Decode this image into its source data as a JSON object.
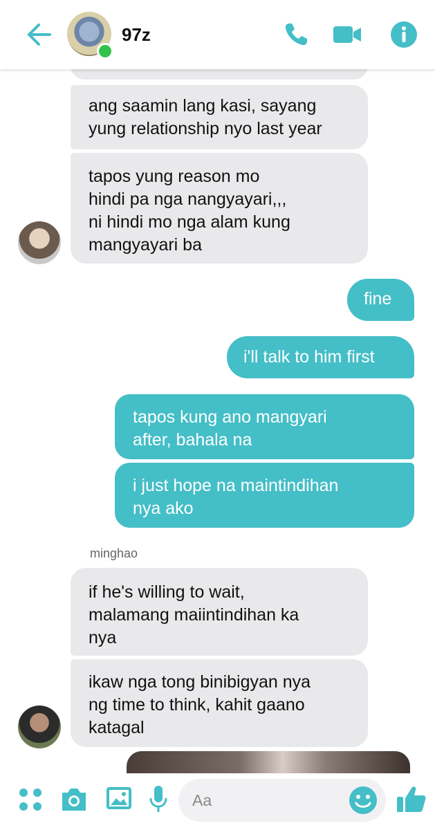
{
  "header": {
    "title": "97z",
    "icons": [
      "back-arrow-icon",
      "phone-icon",
      "video-camera-icon",
      "info-icon"
    ]
  },
  "conversation": {
    "messages": [
      {
        "side": "in",
        "text": "ang saamin lang kasi, sayang\nyung relationship nyo last year"
      },
      {
        "side": "in",
        "text": "tapos yung reason mo\nhindi pa nga nangyayari,,,\nni hindi mo nga alam kung\nmangyayari ba"
      },
      {
        "side": "out",
        "text": "fine"
      },
      {
        "side": "out",
        "text": "i'll talk to him first"
      },
      {
        "side": "out",
        "text": "tapos kung ano mangyari\nafter, bahala na"
      },
      {
        "side": "out",
        "text": "i just hope na maintindihan\nnya ako"
      },
      {
        "side": "in",
        "text": "if he's willing to wait,\nmalamang maiintindihan ka\nnya"
      },
      {
        "side": "in",
        "text": "ikaw nga tong binibigyan nya\nng time to think, kahit gaano\nkatagal"
      }
    ],
    "sender_label": "minghao"
  },
  "composer": {
    "placeholder": "Aa",
    "icons": [
      "apps-icon",
      "camera-icon",
      "gallery-icon",
      "microphone-icon",
      "emoji-icon",
      "like-icon"
    ]
  },
  "colors": {
    "accent": "#44bec7",
    "incoming_bubble": "#e9e9eb",
    "online": "#31c24d"
  }
}
